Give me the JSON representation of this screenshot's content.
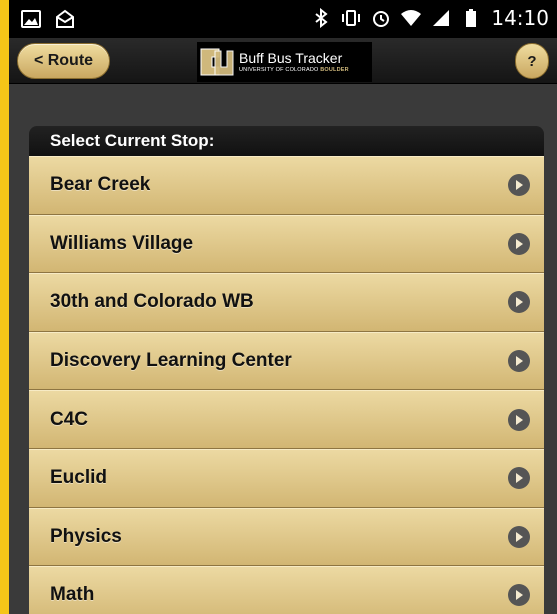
{
  "status_bar": {
    "time": "14:10"
  },
  "header": {
    "back_label": "< Route",
    "help_label": "?",
    "logo_title": "Buff Bus Tracker",
    "logo_subtitle_prefix": "UNIVERSITY OF COLORADO ",
    "logo_subtitle_suffix": "BOULDER"
  },
  "stop_list": {
    "header": "Select Current Stop:",
    "items": [
      {
        "label": "Bear Creek"
      },
      {
        "label": "Williams Village"
      },
      {
        "label": "30th and Colorado WB"
      },
      {
        "label": "Discovery Learning Center"
      },
      {
        "label": "C4C"
      },
      {
        "label": "Euclid"
      },
      {
        "label": "Physics"
      },
      {
        "label": "Math"
      }
    ]
  },
  "colors": {
    "accent": "#f5c518",
    "item_light": "#ecd9a2",
    "item_dark": "#d2b673"
  }
}
